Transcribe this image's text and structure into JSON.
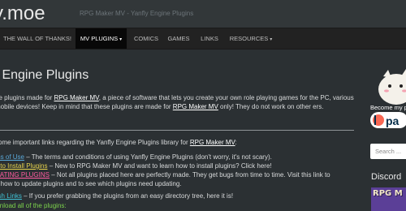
{
  "header": {
    "site_title": "y.moe",
    "site_description": "RPG Maker MV - Yanfly Engine Plugins"
  },
  "nav": {
    "items": [
      {
        "label": "THE WALL OF THANKS!"
      },
      {
        "label": "MV PLUGINS",
        "caret": "▾"
      },
      {
        "label": "COMICS"
      },
      {
        "label": "GAMES"
      },
      {
        "label": "LINKS"
      },
      {
        "label": "RESOURCES",
        "caret": "▾"
      }
    ],
    "active_index": 1
  },
  "page": {
    "title": "v Engine Plugins",
    "intro": {
      "p1": "ne plugins made for ",
      "link1": "RPG Maker MV",
      "p2": ", a piece of software that lets you create your own role playing games for the PC, various mobile devices! Keep in mind that these plugins are made for ",
      "link2": "RPG Maker MV",
      "p3": " only! They do not work on other ers."
    },
    "links_intro": {
      "text": "some important links regarding the Yanfly Engine Plugins library for ",
      "link": "RPG Maker MV",
      "end": ":"
    },
    "links": [
      {
        "link": "ms of Use",
        "desc": " – The terms and conditions of using Yanfly Engine Plugins (don't worry, it's not scary)."
      },
      {
        "link": "y to Install Plugins",
        "desc": " – New to RPG Maker MV and want to learn how to install plugins? Click here!"
      },
      {
        "link": "DATING PLUGINS",
        "desc": " – Not all plugins placed here are perfectly made. They get bugs from time to time. Visit this link to"
      },
      {
        "link": "",
        "desc": "n how to update plugins and to see which plugins need updating."
      },
      {
        "link": "lish Links",
        "desc": " – If you prefer grabbing the plugins from an easy directory tree, here it is!"
      },
      {
        "link": "wnload all of the plugins:",
        "desc": ""
      }
    ]
  },
  "sidebar": {
    "badge_text": "Become my pat",
    "badge_brand": "pa",
    "search_placeholder": "Search ...",
    "discord_title": "Discord",
    "discord_thumb_text": "RPG M"
  },
  "colors": {
    "background": "#2b3033",
    "navbar": "#222222",
    "active_nav": "#080808",
    "link_blue": "#5aa8d8",
    "link_yellow": "#e8d44d",
    "link_pink": "#ff5aa0",
    "link_cyan": "#40c4d8",
    "link_green": "#7cd24c",
    "patreon_orange": "#f96854"
  }
}
